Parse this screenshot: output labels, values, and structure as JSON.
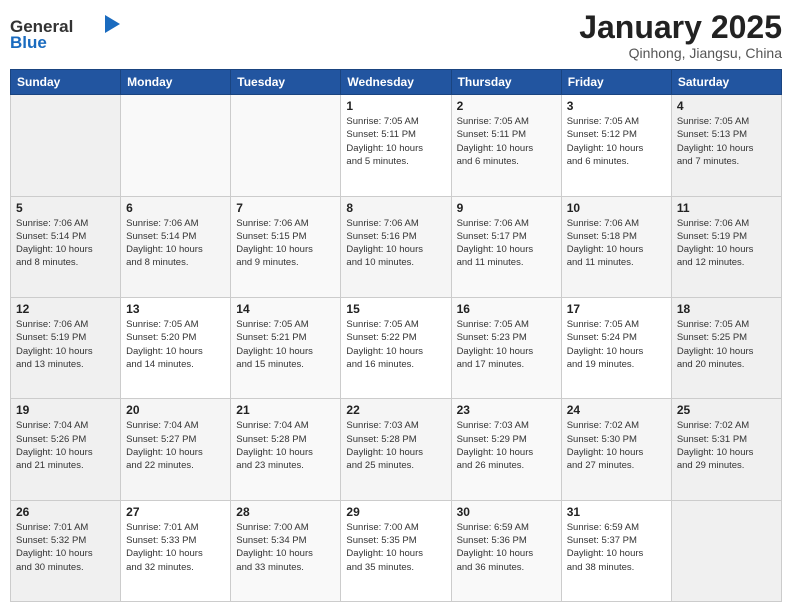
{
  "header": {
    "logo": {
      "text_general": "General",
      "text_blue": "Blue"
    },
    "title": "January 2025",
    "location": "Qinhong, Jiangsu, China"
  },
  "weekdays": [
    "Sunday",
    "Monday",
    "Tuesday",
    "Wednesday",
    "Thursday",
    "Friday",
    "Saturday"
  ],
  "weeks": [
    [
      {
        "num": "",
        "info": ""
      },
      {
        "num": "",
        "info": ""
      },
      {
        "num": "",
        "info": ""
      },
      {
        "num": "1",
        "info": "Sunrise: 7:05 AM\nSunset: 5:11 PM\nDaylight: 10 hours\nand 5 minutes."
      },
      {
        "num": "2",
        "info": "Sunrise: 7:05 AM\nSunset: 5:11 PM\nDaylight: 10 hours\nand 6 minutes."
      },
      {
        "num": "3",
        "info": "Sunrise: 7:05 AM\nSunset: 5:12 PM\nDaylight: 10 hours\nand 6 minutes."
      },
      {
        "num": "4",
        "info": "Sunrise: 7:05 AM\nSunset: 5:13 PM\nDaylight: 10 hours\nand 7 minutes."
      }
    ],
    [
      {
        "num": "5",
        "info": "Sunrise: 7:06 AM\nSunset: 5:14 PM\nDaylight: 10 hours\nand 8 minutes."
      },
      {
        "num": "6",
        "info": "Sunrise: 7:06 AM\nSunset: 5:14 PM\nDaylight: 10 hours\nand 8 minutes."
      },
      {
        "num": "7",
        "info": "Sunrise: 7:06 AM\nSunset: 5:15 PM\nDaylight: 10 hours\nand 9 minutes."
      },
      {
        "num": "8",
        "info": "Sunrise: 7:06 AM\nSunset: 5:16 PM\nDaylight: 10 hours\nand 10 minutes."
      },
      {
        "num": "9",
        "info": "Sunrise: 7:06 AM\nSunset: 5:17 PM\nDaylight: 10 hours\nand 11 minutes."
      },
      {
        "num": "10",
        "info": "Sunrise: 7:06 AM\nSunset: 5:18 PM\nDaylight: 10 hours\nand 11 minutes."
      },
      {
        "num": "11",
        "info": "Sunrise: 7:06 AM\nSunset: 5:19 PM\nDaylight: 10 hours\nand 12 minutes."
      }
    ],
    [
      {
        "num": "12",
        "info": "Sunrise: 7:06 AM\nSunset: 5:19 PM\nDaylight: 10 hours\nand 13 minutes."
      },
      {
        "num": "13",
        "info": "Sunrise: 7:05 AM\nSunset: 5:20 PM\nDaylight: 10 hours\nand 14 minutes."
      },
      {
        "num": "14",
        "info": "Sunrise: 7:05 AM\nSunset: 5:21 PM\nDaylight: 10 hours\nand 15 minutes."
      },
      {
        "num": "15",
        "info": "Sunrise: 7:05 AM\nSunset: 5:22 PM\nDaylight: 10 hours\nand 16 minutes."
      },
      {
        "num": "16",
        "info": "Sunrise: 7:05 AM\nSunset: 5:23 PM\nDaylight: 10 hours\nand 17 minutes."
      },
      {
        "num": "17",
        "info": "Sunrise: 7:05 AM\nSunset: 5:24 PM\nDaylight: 10 hours\nand 19 minutes."
      },
      {
        "num": "18",
        "info": "Sunrise: 7:05 AM\nSunset: 5:25 PM\nDaylight: 10 hours\nand 20 minutes."
      }
    ],
    [
      {
        "num": "19",
        "info": "Sunrise: 7:04 AM\nSunset: 5:26 PM\nDaylight: 10 hours\nand 21 minutes."
      },
      {
        "num": "20",
        "info": "Sunrise: 7:04 AM\nSunset: 5:27 PM\nDaylight: 10 hours\nand 22 minutes."
      },
      {
        "num": "21",
        "info": "Sunrise: 7:04 AM\nSunset: 5:28 PM\nDaylight: 10 hours\nand 23 minutes."
      },
      {
        "num": "22",
        "info": "Sunrise: 7:03 AM\nSunset: 5:28 PM\nDaylight: 10 hours\nand 25 minutes."
      },
      {
        "num": "23",
        "info": "Sunrise: 7:03 AM\nSunset: 5:29 PM\nDaylight: 10 hours\nand 26 minutes."
      },
      {
        "num": "24",
        "info": "Sunrise: 7:02 AM\nSunset: 5:30 PM\nDaylight: 10 hours\nand 27 minutes."
      },
      {
        "num": "25",
        "info": "Sunrise: 7:02 AM\nSunset: 5:31 PM\nDaylight: 10 hours\nand 29 minutes."
      }
    ],
    [
      {
        "num": "26",
        "info": "Sunrise: 7:01 AM\nSunset: 5:32 PM\nDaylight: 10 hours\nand 30 minutes."
      },
      {
        "num": "27",
        "info": "Sunrise: 7:01 AM\nSunset: 5:33 PM\nDaylight: 10 hours\nand 32 minutes."
      },
      {
        "num": "28",
        "info": "Sunrise: 7:00 AM\nSunset: 5:34 PM\nDaylight: 10 hours\nand 33 minutes."
      },
      {
        "num": "29",
        "info": "Sunrise: 7:00 AM\nSunset: 5:35 PM\nDaylight: 10 hours\nand 35 minutes."
      },
      {
        "num": "30",
        "info": "Sunrise: 6:59 AM\nSunset: 5:36 PM\nDaylight: 10 hours\nand 36 minutes."
      },
      {
        "num": "31",
        "info": "Sunrise: 6:59 AM\nSunset: 5:37 PM\nDaylight: 10 hours\nand 38 minutes."
      },
      {
        "num": "",
        "info": ""
      }
    ]
  ]
}
